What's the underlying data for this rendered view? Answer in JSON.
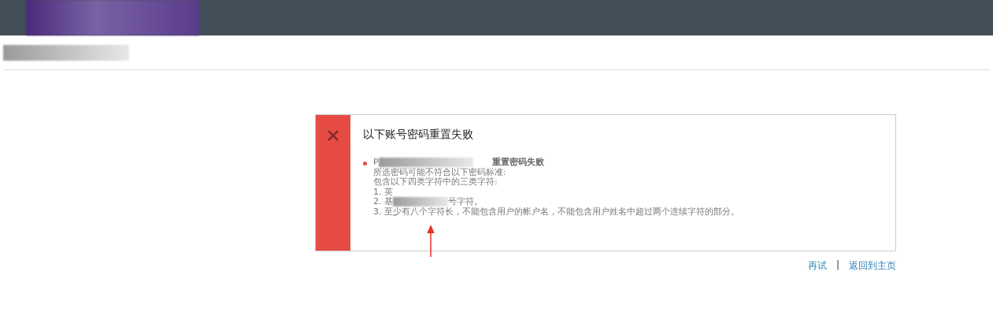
{
  "dialog": {
    "title": "以下账号密码重置失败",
    "failures": [
      {
        "account": "P",
        "status": "重置密码失败",
        "lines": [
          "所选密码可能不符合以下密码标准:",
          "包含以下四类字符中的三类字符:"
        ],
        "rules": [
          {
            "parts": [
              "1. 英"
            ]
          },
          {
            "parts": [
              "2. 基",
              "号字符。"
            ]
          },
          {
            "parts": [
              "3. 至少有八个字符长，不能包含用户的帐户名，不能包含用户姓名中超过两个连续字符的部分。"
            ]
          }
        ]
      }
    ]
  },
  "links": [
    {
      "label": "再试"
    },
    {
      "label": "返回到主页"
    }
  ],
  "separator": "|"
}
